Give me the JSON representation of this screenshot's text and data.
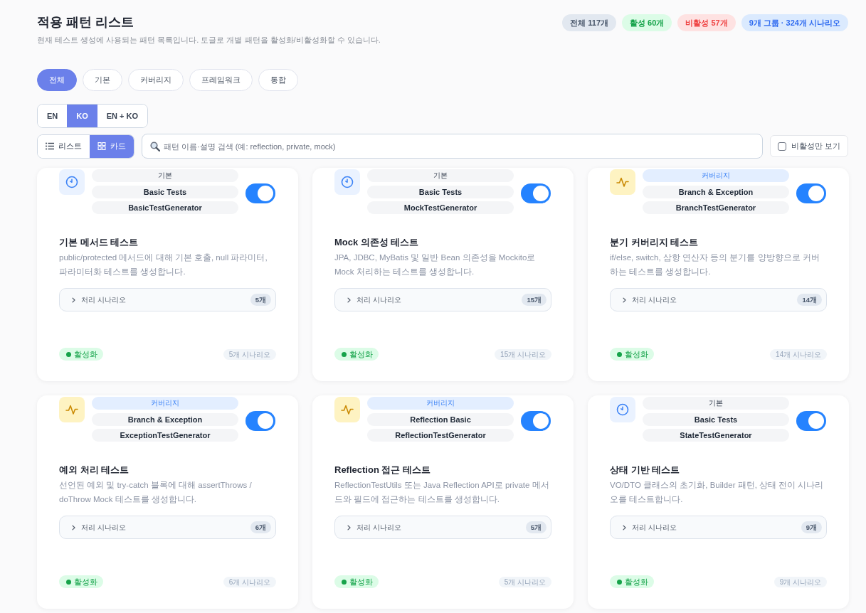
{
  "header": {
    "title": "적용 패턴 리스트",
    "subtitle": "현재 테스트 생성에 사용되는 패턴 목록입니다. 토글로 개별 패턴을 활성화/비활성화할 수 있습니다."
  },
  "summary_badges": [
    {
      "label": "전체 117개",
      "kind": "total"
    },
    {
      "label": "활성 60개",
      "kind": "active"
    },
    {
      "label": "비활성 57개",
      "kind": "inactive"
    },
    {
      "label": "9개 그룹 · 324개 시나리오",
      "kind": "groups"
    }
  ],
  "category_tabs": [
    {
      "label": "전체",
      "selected": true
    },
    {
      "label": "기본",
      "selected": false
    },
    {
      "label": "커버리지",
      "selected": false
    },
    {
      "label": "프레임워크",
      "selected": false
    },
    {
      "label": "통합",
      "selected": false
    }
  ],
  "language_toggle": [
    {
      "label": "EN",
      "selected": false
    },
    {
      "label": "KO",
      "selected": true
    },
    {
      "label": "EN + KO",
      "selected": false
    }
  ],
  "view_toggle": [
    {
      "label": "리스트",
      "kind": "list",
      "selected": false
    },
    {
      "label": "카드",
      "kind": "grid",
      "selected": true
    }
  ],
  "search": {
    "placeholder": "패턴 이름·설명 검색 (예: reflection, private, mock)"
  },
  "inactive_only_filter": {
    "label": "비활성만 보기",
    "checked": false
  },
  "cards": [
    {
      "kind": "basic",
      "category": "기본",
      "group": "Basic Tests",
      "generator": "BasicTestGenerator",
      "enabled": true,
      "title": "기본 메서드 테스트",
      "description": "public/protected 메서드에 대해 기본 호출, null 파라미터, 파라미터화 테스트를 생성합니다.",
      "scenarios": {
        "label": "처리 시나리오",
        "count": "5개",
        "expanded": false
      },
      "status": {
        "label": "활성화",
        "active": true
      },
      "scenario_total": "5개 시나리오"
    },
    {
      "kind": "basic",
      "category": "기본",
      "group": "Basic Tests",
      "generator": "MockTestGenerator",
      "enabled": true,
      "title": "Mock 의존성 테스트",
      "description": "JPA, JDBC, MyBatis 및 일반 Bean 의존성을 Mockito로 Mock 처리하는 테스트를 생성합니다.",
      "scenarios": {
        "label": "처리 시나리오",
        "count": "15개",
        "expanded": false
      },
      "status": {
        "label": "활성화",
        "active": true
      },
      "scenario_total": "15개 시나리오"
    },
    {
      "kind": "coverage",
      "category": "커버리지",
      "group": "Branch & Exception",
      "generator": "BranchTestGenerator",
      "enabled": true,
      "title": "분기 커버리지 테스트",
      "description": "if/else, switch, 삼항 연산자 등의 분기를 양방향으로 커버하는 테스트를 생성합니다.",
      "scenarios": {
        "label": "처리 시나리오",
        "count": "14개",
        "expanded": false
      },
      "status": {
        "label": "활성화",
        "active": true
      },
      "scenario_total": "14개 시나리오"
    },
    {
      "kind": "coverage",
      "category": "커버리지",
      "group": "Branch & Exception",
      "generator": "ExceptionTestGenerator",
      "enabled": true,
      "title": "예외 처리 테스트",
      "description": "선언된 예외 및 try-catch 블록에 대해 assertThrows / doThrow Mock 테스트를 생성합니다.",
      "scenarios": {
        "label": "처리 시나리오",
        "count": "6개",
        "expanded": false
      },
      "status": {
        "label": "활성화",
        "active": true
      },
      "scenario_total": "6개 시나리오"
    },
    {
      "kind": "coverage",
      "category": "커버리지",
      "group": "Reflection Basic",
      "generator": "ReflectionTestGenerator",
      "enabled": true,
      "title": "Reflection 접근 테스트",
      "description": "ReflectionTestUtils 또는 Java Reflection API로 private 메서드와 필드에 접근하는 테스트를 생성합니다.",
      "scenarios": {
        "label": "처리 시나리오",
        "count": "5개",
        "expanded": false
      },
      "status": {
        "label": "활성화",
        "active": true
      },
      "scenario_total": "5개 시나리오"
    },
    {
      "kind": "basic",
      "category": "기본",
      "group": "Basic Tests",
      "generator": "StateTestGenerator",
      "enabled": true,
      "title": "상태 기반 테스트",
      "description": "VO/DTO 클래스의 초기화, Builder 패턴, 상태 전이 시나리오를 테스트합니다.",
      "scenarios": {
        "label": "처리 시나리오",
        "count": "9개",
        "expanded": false
      },
      "status": {
        "label": "활성화",
        "active": true
      },
      "scenario_total": "9개 시나리오"
    }
  ]
}
